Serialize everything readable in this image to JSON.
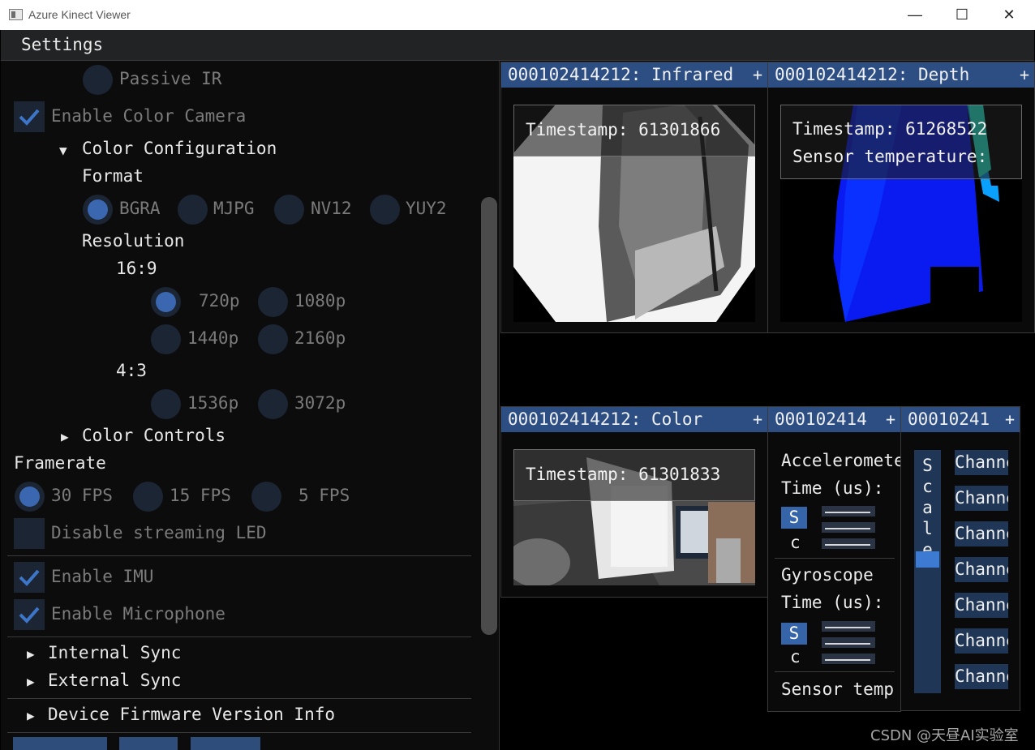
{
  "window": {
    "title": "Azure Kinect Viewer",
    "minimize": "—",
    "maximize": "☐",
    "close": "✕"
  },
  "menu": {
    "settings": "Settings"
  },
  "settings": {
    "passive_ir": "Passive IR",
    "enable_color_camera": "Enable Color Camera",
    "color_configuration": "Color Configuration",
    "format_label": "Format",
    "formats": [
      "BGRA",
      "MJPG",
      "NV12",
      "YUY2"
    ],
    "selected_format": "BGRA",
    "resolution_label": "Resolution",
    "ratio_16_9": "16:9",
    "res_16_9": [
      "720p",
      "1080p",
      "1440p",
      "2160p"
    ],
    "ratio_4_3": "4:3",
    "res_4_3": [
      "1536p",
      "3072p"
    ],
    "selected_resolution": "720p",
    "color_controls": "Color Controls",
    "framerate_label": "Framerate",
    "framerates": [
      "30 FPS",
      "15 FPS",
      "5 FPS"
    ],
    "selected_framerate": "30 FPS",
    "disable_led": "Disable streaming LED",
    "enable_imu": "Enable IMU",
    "enable_microphone": "Enable Microphone",
    "internal_sync": "Internal Sync",
    "external_sync": "External Sync",
    "firmware_info": "Device Firmware Version Info"
  },
  "panes": {
    "infrared": {
      "title": "000102414212: Infrared",
      "timestamp": "Timestamp: 61301866"
    },
    "depth": {
      "title": "000102414212: Depth",
      "timestamp": "Timestamp: 61268522",
      "sensor_temp": "Sensor temperature:"
    },
    "color": {
      "title": "000102414212: Color",
      "timestamp": "Timestamp: 61301833"
    },
    "imu": {
      "title": "000102414",
      "accel": "Accelerometer",
      "time1": "Time (us):",
      "sc1a": "S",
      "sc1b": "c",
      "gyro": "Gyroscope",
      "time2": "Time (us):",
      "sc2a": "S",
      "sc2b": "c",
      "sensor_temp": "Sensor temp"
    },
    "mic": {
      "title": "00010241",
      "scale": [
        "S",
        "c",
        "a",
        "l",
        "e"
      ],
      "channels": [
        "Channel",
        "Channel",
        "Channel",
        "Channel",
        "Channel",
        "Channel",
        "Channel"
      ]
    },
    "plus": "+"
  },
  "watermark": "CSDN @天昼AI实验室"
}
